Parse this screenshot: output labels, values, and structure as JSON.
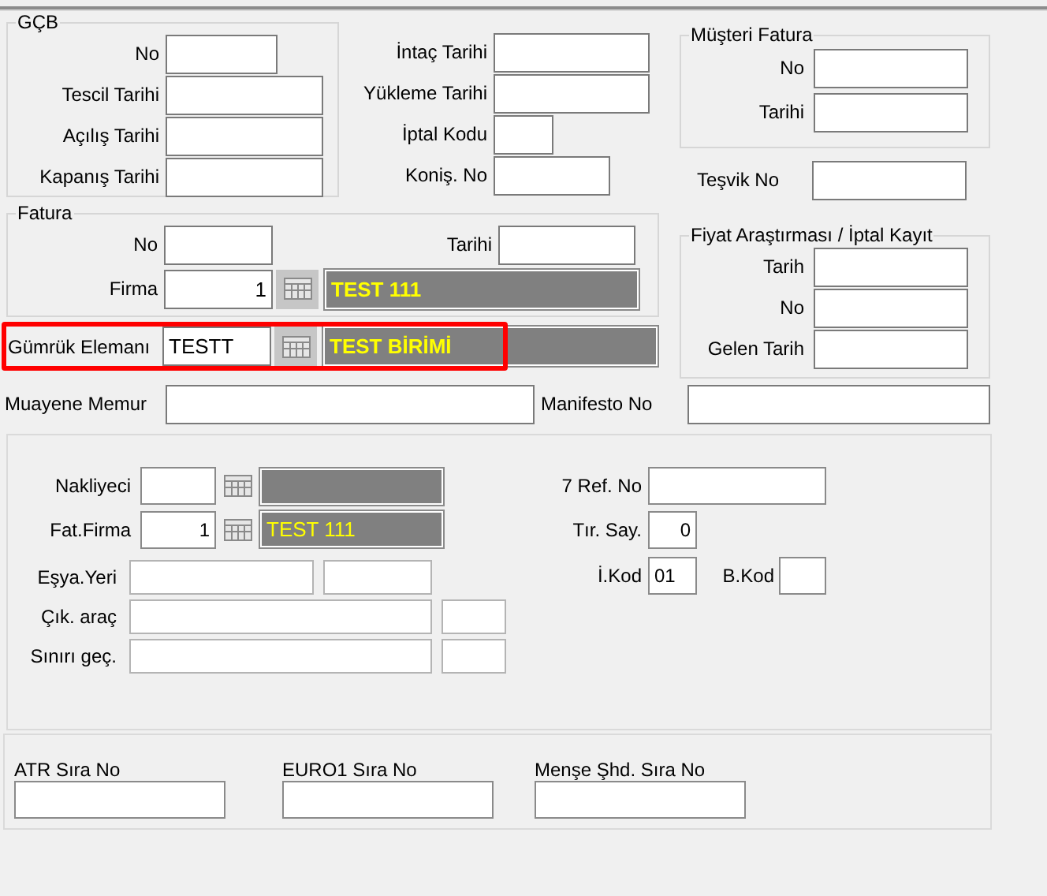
{
  "gcb": {
    "title": "GÇB",
    "fields": [
      {
        "label": "No"
      },
      {
        "label": "Tescil Tarihi"
      },
      {
        "label": "Açılış Tarihi"
      },
      {
        "label": "Kapanış Tarihi"
      }
    ]
  },
  "dates": [
    {
      "label": "İntaç Tarihi"
    },
    {
      "label": "Yükleme Tarihi"
    },
    {
      "label": "İptal Kodu"
    },
    {
      "label": "Koniş. No"
    }
  ],
  "musteri_fatura": {
    "title": "Müşteri Fatura",
    "fields": [
      {
        "label": "No"
      },
      {
        "label": "Tarihi"
      }
    ]
  },
  "tesvik_no": {
    "label": "Teşvik No"
  },
  "fatura": {
    "title": "Fatura",
    "no": {
      "label": "No"
    },
    "tarihi": {
      "label": "Tarihi"
    },
    "firma": {
      "label": "Firma",
      "value": "1",
      "name": "TEST 111"
    }
  },
  "fiyat_arastirmasi": {
    "title": "Fiyat Araştırması / İptal Kayıt",
    "fields": [
      {
        "label": "Tarih"
      },
      {
        "label": "No"
      },
      {
        "label": "Gelen Tarih"
      }
    ]
  },
  "gumruk_elemani": {
    "label": "Gümrük Elemanı",
    "value": "TESTT",
    "name": "TEST BİRİMİ",
    "highlighted": true
  },
  "muayene_memur": {
    "label": "Muayene Memur"
  },
  "manifesto_no": {
    "label": "Manifesto No"
  },
  "tasima": {
    "nakliyeci": {
      "label": "Nakliyeci"
    },
    "fat_firma": {
      "label": "Fat.Firma",
      "value": "1",
      "name": "TEST 111"
    },
    "ref_no": {
      "label": "7 Ref. No"
    },
    "tir_sayisi": {
      "label": "Tır. Say.",
      "value": "0"
    },
    "i_kod": {
      "label": "İ.Kod",
      "value": "01"
    },
    "b_kod": {
      "label": "B.Kod"
    },
    "esya_yeri": {
      "label": "Eşya.Yeri"
    },
    "cikis_arac": {
      "label": "Çık. araç"
    },
    "siniri_gecis": {
      "label": "Sınırı geç."
    }
  },
  "sira_numaralari": [
    {
      "label": "ATR Sıra No"
    },
    {
      "label": "EURO1 Sıra No"
    },
    {
      "label": "Menşe Şhd. Sıra No"
    }
  ]
}
